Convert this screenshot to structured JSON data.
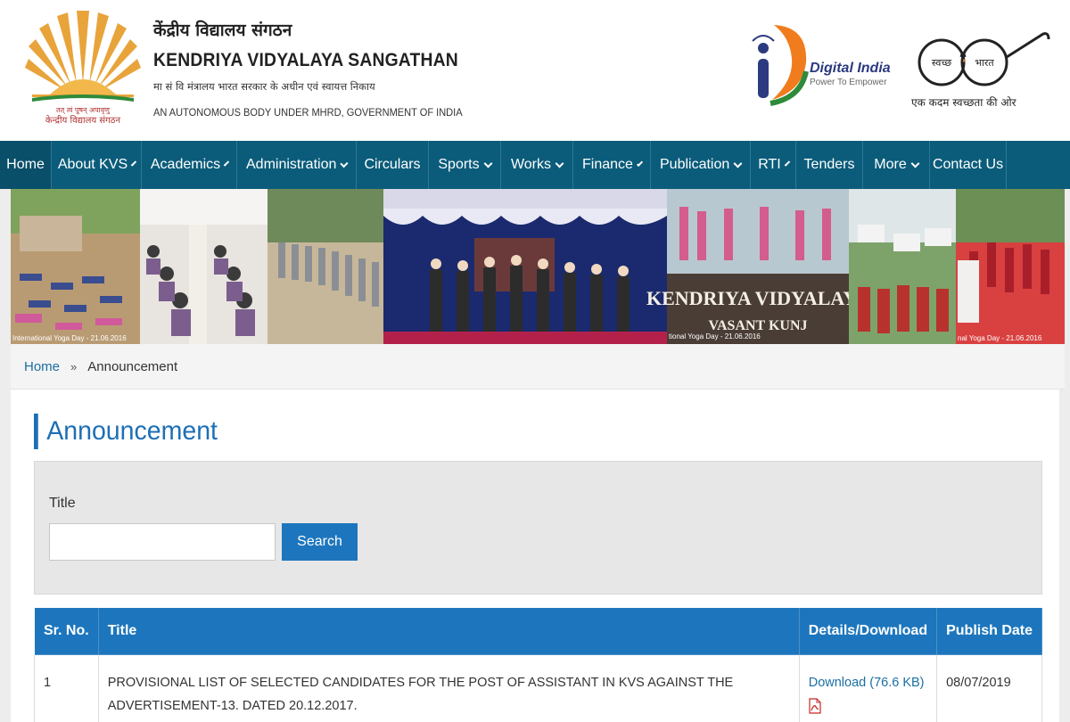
{
  "header": {
    "org_name_hindi": "केंद्रीय विद्यालय संगठन",
    "org_name_english": "KENDRIYA VIDYALAYA SANGATHAN",
    "subtitle_hindi": "मा सं वि मंत्रालय भारत सरकार के अधीन एवं स्वायत्त निकाय",
    "subtitle_english": "AN AUTONOMOUS BODY UNDER MHRD, GOVERNMENT OF INDIA",
    "logo_caption_top": "तत् त्वं पूषन् अपावृणु",
    "logo_caption_bottom": "केन्द्रीय विद्यालय संगठन",
    "digital_india_title": "Digital India",
    "digital_india_tagline": "Power To Empower",
    "swachh_left": "स्वच्छ",
    "swachh_right": "भारत",
    "swachh_caption": "एक कदम स्वच्छता की ओर"
  },
  "nav": {
    "items": [
      {
        "label": "Home",
        "dropdown": false
      },
      {
        "label": "About KVS",
        "dropdown": true
      },
      {
        "label": "Academics",
        "dropdown": true
      },
      {
        "label": "Administration",
        "dropdown": true
      },
      {
        "label": "Circulars",
        "dropdown": false
      },
      {
        "label": "Sports",
        "dropdown": true
      },
      {
        "label": "Works",
        "dropdown": true
      },
      {
        "label": "Finance",
        "dropdown": true
      },
      {
        "label": "Publication",
        "dropdown": true
      },
      {
        "label": "RTI",
        "dropdown": true
      },
      {
        "label": "Tenders",
        "dropdown": false
      },
      {
        "label": "More",
        "dropdown": true
      },
      {
        "label": "Contact Us",
        "dropdown": false
      }
    ]
  },
  "banner": {
    "school_sign_line1": "KENDRIYA VIDYALAYA",
    "school_sign_line2": "VASANT KUNJ",
    "caption_left": "International Yoga Day - 21.06.2016",
    "caption_mid": "tional Yoga Day - 21.06.2016",
    "caption_right": "nal Yoga Day - 21.06.2016"
  },
  "breadcrumb": {
    "home": "Home",
    "separator": "»",
    "current": "Announcement"
  },
  "page": {
    "title": "Announcement"
  },
  "filter": {
    "label": "Title",
    "input_value": "",
    "button_label": "Search"
  },
  "table": {
    "headers": [
      "Sr. No.",
      "Title",
      "Details/Download",
      "Publish Date"
    ],
    "rows": [
      {
        "sr": "1",
        "title": "PROVISIONAL LIST OF SELECTED CANDIDATES FOR THE POST OF ASSISTANT IN KVS AGAINST THE ADVERTISEMENT-13. DATED 20.12.2017.",
        "download": "Download (76.6 KB)",
        "date": "08/07/2019"
      }
    ]
  },
  "colors": {
    "nav_bg": "#0b5c7a",
    "accent_blue": "#1d76bd",
    "link": "#1a6fa3",
    "title_blue": "#1d6fb5"
  },
  "icons": {
    "nav_dropdown": "chevron-down-icon",
    "file": "pdf-icon"
  }
}
